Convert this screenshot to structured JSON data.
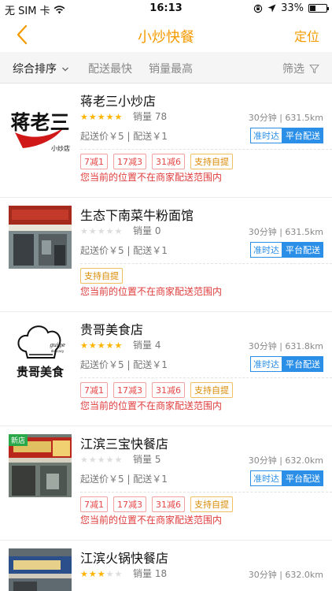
{
  "status_bar": {
    "carrier": "无 SIM 卡",
    "time": "16:13",
    "battery": "33%",
    "battery_level": 0.33
  },
  "nav": {
    "title": "小炒快餐",
    "locate_label": "定位"
  },
  "filter": {
    "sort_label": "综合排序",
    "fastest_label": "配送最快",
    "sales_label": "销量最高",
    "filter_label": "筛选"
  },
  "colors": {
    "accent": "#f59a00",
    "star": "#ffb400",
    "warning": "#e03c3c",
    "badge_blue": "#2b8fe8",
    "new_badge": "#2ba84a"
  },
  "shops": [
    {
      "name": "蒋老三小炒店",
      "rating": 5,
      "sales": "销量 78",
      "time_distance": "30分钟 | 631.5km",
      "fees": "起送价￥5 | 配送￥1",
      "ontime_badge": "准时达",
      "platform_badge": "平台配送",
      "promos": [
        "7减1",
        "17减3",
        "31减6"
      ],
      "pickup": "支持自提",
      "warning": "您当前的位置不在商家配送范围内",
      "logo_text": "蒋老三",
      "logo_sub": "小炒店",
      "thumb_icon": "logo-calligraphy-icon"
    },
    {
      "name": "生态下南菜牛粉面馆",
      "rating": 0,
      "sales": "销量 0",
      "time_distance": "30分钟 | 631.5km",
      "fees": "起送价￥5 | 配送￥1",
      "ontime_badge": "准时达",
      "platform_badge": "平台配送",
      "promos": [],
      "pickup": "支持自提",
      "warning": "您当前的位置不在商家配送范围内",
      "thumb_icon": "storefront-photo-icon"
    },
    {
      "name": "贵哥美食店",
      "rating": 5,
      "sales": "销量 4",
      "time_distance": "30分钟 | 631.8km",
      "fees": "起送价￥5 | 配送￥1",
      "ontime_badge": "准时达",
      "platform_badge": "平台配送",
      "promos": [
        "7减1",
        "17减3",
        "31减6"
      ],
      "pickup": "支持自提",
      "warning": "您当前的位置不在商家配送范围内",
      "logo_text": "贵哥美食",
      "logo_en": "guige",
      "logo_en_sub": "delicacy",
      "thumb_icon": "chef-hat-icon"
    },
    {
      "name": "江滨三宝快餐店",
      "rating": 0,
      "sales": "销量 5",
      "time_distance": "30分钟 | 632.0km",
      "fees": "起送价￥5 | 配送￥1",
      "ontime_badge": "准时达",
      "platform_badge": "平台配送",
      "promos": [
        "7减1",
        "17减3",
        "31减6"
      ],
      "pickup": "支持自提",
      "warning": "您当前的位置不在商家配送范围内",
      "new_badge": "新店",
      "thumb_icon": "storefront-photo-icon"
    },
    {
      "name": "江滨火锅快餐店",
      "rating": 3,
      "sales": "销量 18",
      "time_distance": "30分钟 | 632.0km",
      "thumb_icon": "storefront-photo-icon"
    }
  ]
}
